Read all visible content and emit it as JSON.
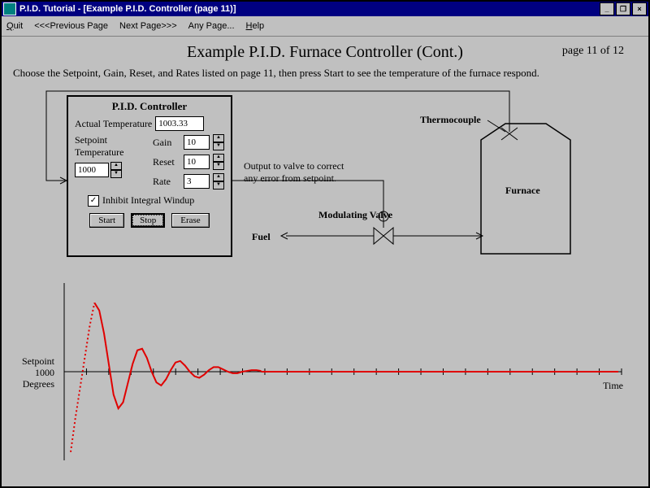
{
  "window": {
    "title": "P.I.D. Tutorial - [Example P.I.D. Controller (page 11)]"
  },
  "menu": {
    "quit": "Quit",
    "prev": "<<<Previous Page",
    "next": "Next Page>>>",
    "any": "Any Page...",
    "help": "Help"
  },
  "page": {
    "heading": "Example P.I.D. Furnace Controller (Cont.)",
    "page_of": "page 11 of 12",
    "instruction": "Choose the Setpoint, Gain, Reset, and Rates listed on page 11, then press Start to see the temperature of the furnace respond."
  },
  "pid": {
    "title": "P.I.D. Controller",
    "actual_label": "Actual Temperature",
    "actual_value": "1003.33",
    "setpoint_label1": "Setpoint",
    "setpoint_label2": "Temperature",
    "setpoint_value": "1000",
    "gain_label": "Gain",
    "gain_value": "10",
    "reset_label": "Reset",
    "reset_value": "10",
    "rate_label": "Rate",
    "rate_value": "3",
    "inhibit_label": "Inhibit Integral Windup",
    "inhibit_checked": "✓",
    "start_btn": "Start",
    "stop_btn": "Stop",
    "erase_btn": "Erase"
  },
  "diagram": {
    "output_line1": "Output to valve to correct",
    "output_line2": "any error from setpoint.",
    "fuel": "Fuel",
    "modvalve": "Modulating Valve",
    "thermocouple": "Thermocouple",
    "furnace": "Furnace"
  },
  "graph": {
    "y1": "Setpoint",
    "y2": "1000",
    "y3": "Degrees",
    "x": "Time"
  },
  "chart_data": {
    "type": "line",
    "title": "",
    "xlabel": "Time",
    "ylabel": "Setpoint 1000 Degrees",
    "ylim": [
      -110,
      110
    ],
    "x": [
      0,
      1,
      2,
      3,
      4,
      5,
      6,
      7,
      8,
      9,
      10,
      11,
      12,
      13,
      14,
      15,
      16,
      17,
      18,
      19,
      20,
      21,
      22,
      23,
      24,
      25,
      26,
      27,
      28,
      29,
      30,
      31,
      32,
      33,
      34,
      35,
      36,
      37,
      38,
      39,
      40
    ],
    "series": [
      {
        "name": "dotted_rise",
        "style": "dotted",
        "values": [
          -105,
          -60,
          -20,
          20,
          60,
          90,
          null,
          null,
          null,
          null,
          null,
          null,
          null,
          null,
          null,
          null,
          null,
          null,
          null,
          null,
          null,
          null,
          null,
          null,
          null,
          null,
          null,
          null,
          null,
          null,
          null,
          null,
          null,
          null,
          null,
          null,
          null,
          null,
          null,
          null,
          null
        ]
      },
      {
        "name": "control_response",
        "style": "solid",
        "values": [
          null,
          null,
          null,
          null,
          null,
          90,
          80,
          50,
          10,
          -30,
          -48,
          -40,
          -15,
          10,
          28,
          30,
          18,
          0,
          -14,
          -18,
          -10,
          2,
          12,
          14,
          8,
          0,
          -6,
          -8,
          -4,
          2,
          6,
          6,
          3,
          0,
          -2,
          -2,
          0,
          1,
          2,
          2,
          1
        ]
      }
    ],
    "baseline": 0,
    "baseline_ticks": 25
  }
}
